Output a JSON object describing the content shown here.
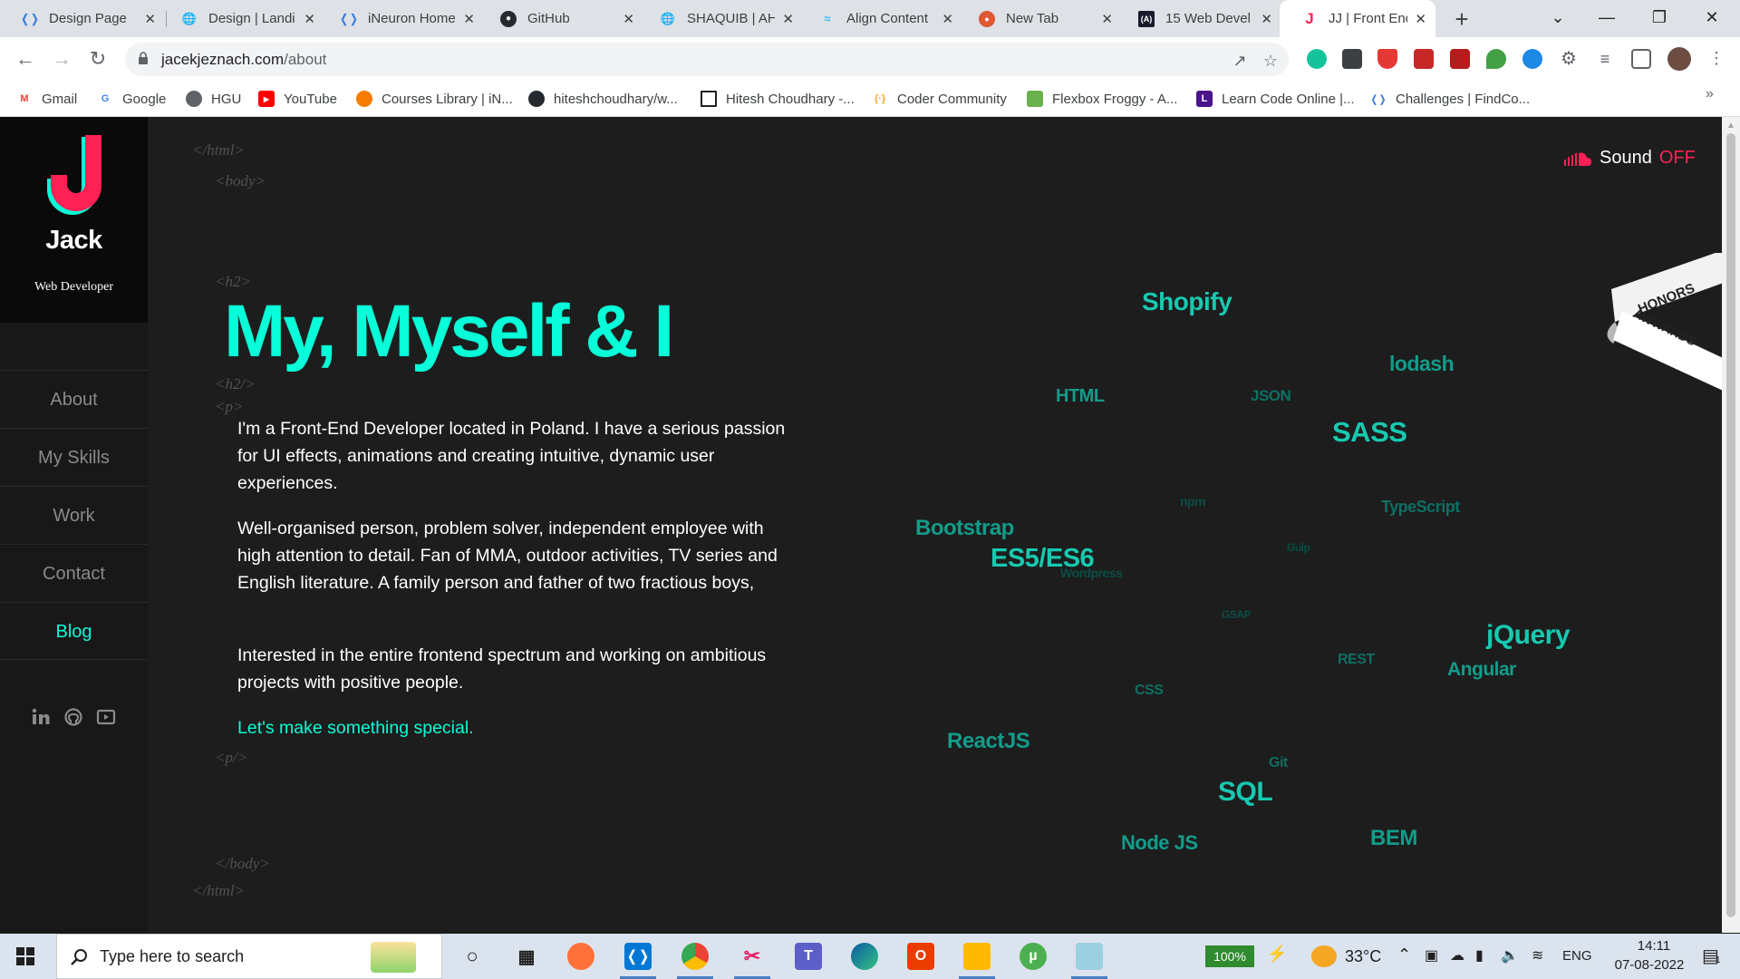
{
  "browser": {
    "tabs": [
      {
        "label": "Design Page",
        "icon": "vscode-dev-icon",
        "active": false
      },
      {
        "label": "Design | Landi",
        "icon": "globe-icon",
        "active": false
      },
      {
        "label": "iNeuron Home",
        "icon": "vscode-dev-icon",
        "active": false
      },
      {
        "label": "GitHub",
        "icon": "github-icon",
        "active": false
      },
      {
        "label": "SHAQUIB | AH",
        "icon": "globe-icon",
        "active": false
      },
      {
        "label": "Align Content",
        "icon": "tailwind-icon",
        "active": false
      },
      {
        "label": "New Tab",
        "icon": "duckduckgo-icon",
        "active": false
      },
      {
        "label": "15 Web Devel",
        "icon": "codrops-icon",
        "active": false
      },
      {
        "label": "JJ | Front End",
        "icon": "jj-logo-icon",
        "active": true
      }
    ],
    "url_host": "jacekjeznach.com",
    "url_path": "/about",
    "bookmarks": [
      {
        "label": "Gmail",
        "color": "#ea4335",
        "glyph": "M"
      },
      {
        "label": "Google",
        "color": "#4285f4",
        "glyph": "G"
      },
      {
        "label": "HGU",
        "color": "#5f6368",
        "glyph": "●"
      },
      {
        "label": "YouTube",
        "color": "#ff0000",
        "glyph": "▶"
      },
      {
        "label": "Courses Library | iN...",
        "color": "#f57c00",
        "glyph": "●"
      },
      {
        "label": "hiteshchoudhary/w...",
        "color": "#24292e",
        "glyph": "●"
      },
      {
        "label": "Hitesh Choudhary -...",
        "color": "#ffffff",
        "glyph": ""
      },
      {
        "label": "Coder Community",
        "color": "#f6a623",
        "glyph": "{}"
      },
      {
        "label": "Flexbox Froggy - A...",
        "color": "#6ab04c",
        "glyph": "▲"
      },
      {
        "label": "Learn Code Online |...",
        "color": "#4a148c",
        "glyph": "L"
      },
      {
        "label": "Challenges | FindCo...",
        "color": "#2979ff",
        "glyph": "◇"
      }
    ]
  },
  "site": {
    "logo_letter": "J",
    "name": "Jack",
    "role": "Web Developer",
    "menu": [
      "About",
      "My Skills",
      "Work",
      "Contact",
      "Blog"
    ],
    "active_menu": "Blog",
    "social": [
      "linkedin-icon",
      "github-icon",
      "youtube-icon"
    ],
    "sound_label": "Sound",
    "sound_value": "OFF",
    "tags": {
      "html_close_top": "</html>",
      "body_top": "<body>",
      "h2_open": "<h2>",
      "h2_close": "<h2/>",
      "p_open": "<p>",
      "p_close": "<p/>",
      "body_close": "</body>",
      "html_close_bottom": "</html>"
    },
    "heading": "My, Myself & I",
    "paragraphs": [
      "I'm a Front-End Developer located in Poland. I have a serious passion for UI effects, animations and creating intuitive, dynamic user experiences.",
      "Well-organised person, problem solver, independent employee with high attention to detail. Fan of MMA, outdoor activities, TV series and English literature. A family person and father of two fractious boys,",
      "Interested in the entire frontend spectrum and working on ambitious projects with positive people."
    ],
    "cta": "Let's make something special.",
    "ribbon_top": "HONORS",
    "ribbon_bottom": "AWWARDS",
    "skill_words": [
      {
        "text": "Shopify",
        "tone": "bright"
      },
      {
        "text": "lodash",
        "tone": "mid"
      },
      {
        "text": "HTML",
        "tone": "mid"
      },
      {
        "text": "JSON",
        "tone": "dim"
      },
      {
        "text": "SASS",
        "tone": "bright"
      },
      {
        "text": "npm",
        "tone": "faint"
      },
      {
        "text": "TypeScript",
        "tone": "dim"
      },
      {
        "text": "Bootstrap",
        "tone": "mid"
      },
      {
        "text": "ES5/ES6",
        "tone": "bright"
      },
      {
        "text": "Wordpress",
        "tone": "faint"
      },
      {
        "text": "Gulp",
        "tone": "faint"
      },
      {
        "text": "GSAP",
        "tone": "faint"
      },
      {
        "text": "jQuery",
        "tone": "bright"
      },
      {
        "text": "REST",
        "tone": "dim"
      },
      {
        "text": "Angular",
        "tone": "mid"
      },
      {
        "text": "CSS",
        "tone": "dim"
      },
      {
        "text": "ReactJS",
        "tone": "mid"
      },
      {
        "text": "Git",
        "tone": "dim"
      },
      {
        "text": "SQL",
        "tone": "bright"
      },
      {
        "text": "Node JS",
        "tone": "mid"
      },
      {
        "text": "BEM",
        "tone": "mid"
      }
    ]
  },
  "taskbar": {
    "search_placeholder": "Type here to search",
    "battery": "100%",
    "temperature": "33°C",
    "language": "ENG",
    "time": "14:11",
    "date": "07-08-2022",
    "notifications": "1"
  },
  "colors": {
    "accent": "#08fdd8",
    "brand_pink": "#fd2155",
    "background": "#1d1d1d",
    "sidebar": "#181818"
  }
}
